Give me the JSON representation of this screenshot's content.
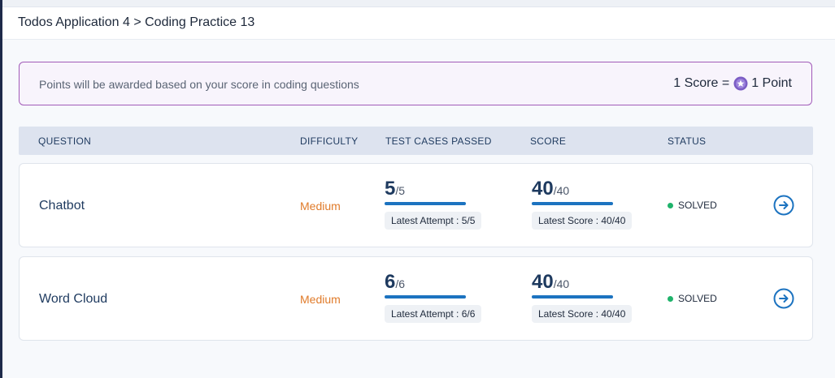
{
  "breadcrumb": "Todos Application 4 > Coding Practice 13",
  "banner": {
    "info_text": "Points will be awarded based on your score in coding questions",
    "rate_left": "1 Score =",
    "rate_right": "1 Point",
    "coin_icon": "star-coin-icon"
  },
  "table": {
    "headers": [
      "QUESTION",
      "DIFFICULTY",
      "TEST CASES PASSED",
      "SCORE",
      "STATUS"
    ],
    "rows": [
      {
        "question": "Chatbot",
        "difficulty": "Medium",
        "tests_value": "5",
        "tests_total": "/5",
        "tests_fraction": 1.0,
        "latest_attempt": "Latest Attempt : 5/5",
        "score_value": "40",
        "score_total": "/40",
        "score_fraction": 1.0,
        "latest_score": "Latest Score : 40/40",
        "status": "SOLVED"
      },
      {
        "question": "Word Cloud",
        "difficulty": "Medium",
        "tests_value": "6",
        "tests_total": "/6",
        "tests_fraction": 1.0,
        "latest_attempt": "Latest Attempt : 6/6",
        "score_value": "40",
        "score_total": "/40",
        "score_fraction": 1.0,
        "latest_score": "Latest Score : 40/40",
        "status": "SOLVED"
      }
    ]
  },
  "colors": {
    "accent": "#1c73c0",
    "difficulty_medium": "#e07b2a",
    "solved": "#1fb36b",
    "banner_border": "#a15ab8",
    "coin": "#7b5cc4"
  }
}
